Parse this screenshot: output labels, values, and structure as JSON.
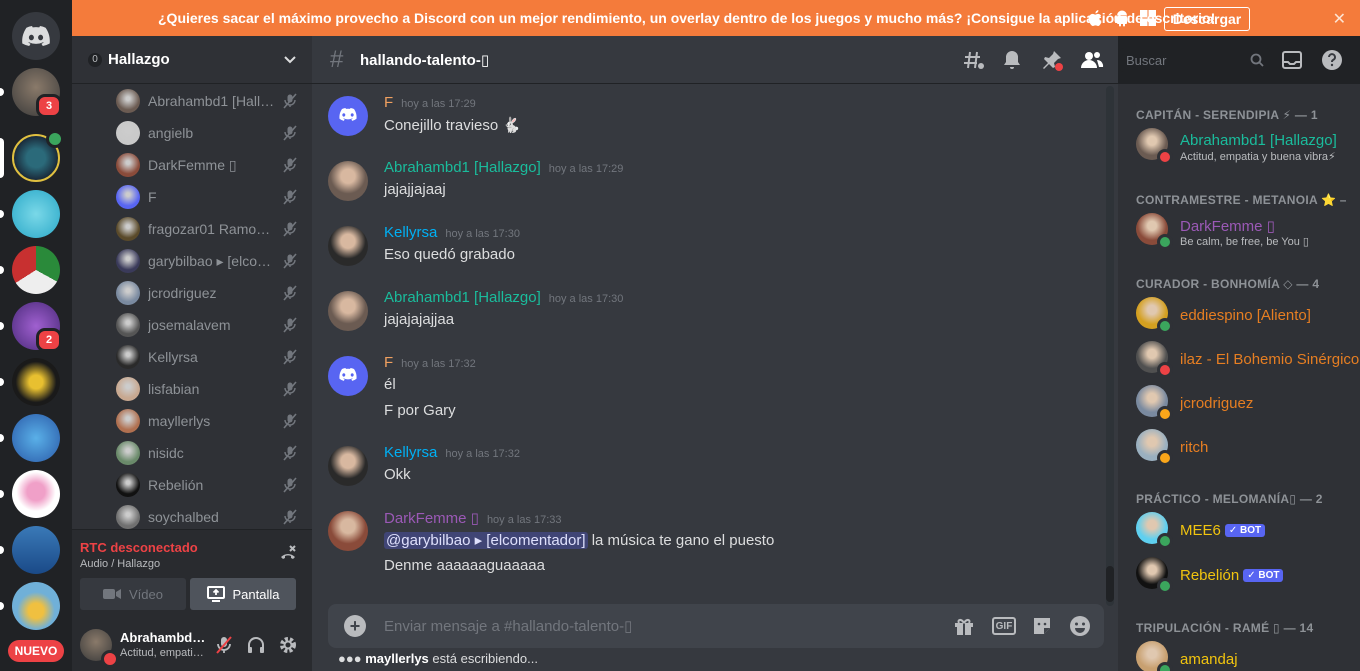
{
  "banner": {
    "text": "¿Quieres sacar el máximo provecho a Discord con un mejor rendimiento, un overlay dentro de los juegos y mucho más? ¡Consigue la aplicación de escritorio!",
    "download_label": "Descargar",
    "close_glyph": "✕"
  },
  "servers": [
    {
      "badge": "3"
    },
    {
      "badge": ""
    },
    {
      "badge": ""
    },
    {
      "badge": ""
    },
    {
      "badge": "2"
    },
    {
      "badge": ""
    },
    {
      "badge": ""
    },
    {
      "badge": ""
    },
    {
      "badge": ""
    },
    {
      "badge": ""
    }
  ],
  "new_label": "NUEVO",
  "guild": {
    "boost": "0",
    "name": "Hallazgo"
  },
  "voice_users": [
    {
      "name": "Abrahambd1 [Hallazgo]",
      "color": "#6b5b52"
    },
    {
      "name": "angielb",
      "color": "#c9c9c9"
    },
    {
      "name": "DarkFemme ▯",
      "color": "#8a4b3a"
    },
    {
      "name": "F",
      "color": "#5865f2"
    },
    {
      "name": "fragozar01 Ramon Fragoza",
      "color": "#5a4a2a"
    },
    {
      "name": "garybilbao ▸ [elcomentador]",
      "color": "#3a3a5a"
    },
    {
      "name": "jcrodriguez",
      "color": "#7a8aa0"
    },
    {
      "name": "josemalavem",
      "color": "#555555"
    },
    {
      "name": "Kellyrsa",
      "color": "#2a2a2a"
    },
    {
      "name": "lisfabian",
      "color": "#c8a890"
    },
    {
      "name": "mayllerlys",
      "color": "#b07050"
    },
    {
      "name": "nisidc",
      "color": "#6a8a6a"
    },
    {
      "name": "Rebelión",
      "color": "#111111"
    },
    {
      "name": "soychalbed",
      "color": "#707070"
    }
  ],
  "rtc": {
    "status": "RTC desconectado",
    "sub": "Audio / Hallazgo",
    "video_label": "Vídeo",
    "screen_label": "Pantalla"
  },
  "user": {
    "name": "Abrahambd1 [Hallazgo]",
    "status": "Actitud, empatia y buena vibra"
  },
  "channel": {
    "name": "hallando-talento-▯",
    "search_placeholder": "Buscar"
  },
  "messages": [
    {
      "author": "F",
      "color": "#f0a060",
      "time": "hoy a las 17:29",
      "lines": [
        "Conejillo travieso 🐇"
      ],
      "avatar": "#5865f2"
    },
    {
      "author": "Abrahambd1 [Hallazgo]",
      "color": "#1abc9c",
      "time": "hoy a las 17:29",
      "lines": [
        "jajajjajaaj"
      ],
      "avatar": "#6b5b52"
    },
    {
      "author": "Kellyrsa",
      "color": "#00b0f4",
      "time": "hoy a las 17:30",
      "lines": [
        "Eso quedó grabado"
      ],
      "avatar": "#2a2a2a"
    },
    {
      "author": "Abrahambd1 [Hallazgo]",
      "color": "#1abc9c",
      "time": "hoy a las 17:30",
      "lines": [
        "jajajajajjaa"
      ],
      "avatar": "#6b5b52"
    },
    {
      "author": "F",
      "color": "#f0a060",
      "time": "hoy a las 17:32",
      "lines": [
        "él",
        "F por Gary"
      ],
      "avatar": "#5865f2"
    },
    {
      "author": "Kellyrsa",
      "color": "#00b0f4",
      "time": "hoy a las 17:32",
      "lines": [
        "Okk"
      ],
      "avatar": "#2a2a2a"
    },
    {
      "author": "DarkFemme ▯",
      "color": "#9b59b6",
      "time": "hoy a las 17:33",
      "mention": "@garybilbao ▸ [elcomentador]",
      "lines": [
        "la música te gano el puesto",
        "Denme aaaaaaguaaaaa"
      ],
      "avatar": "#8a4b3a"
    }
  ],
  "composer": {
    "placeholder": "Enviar mensaje a #hallando-talento-▯",
    "gif_label": "GIF"
  },
  "typing": {
    "user": "mayllerlys",
    "text": "está escribiendo..."
  },
  "members": {
    "categories": [
      {
        "label": "CAPITÁN - SERENDIPIA ⚡ — 1"
      },
      {
        "label": "CONTRAMESTRE - METANOIA ⭐ — 1"
      },
      {
        "label": "CURADOR - BONHOMÍA ◇ — 4"
      },
      {
        "label": "PRÁCTICO - MELOMANÍA▯ — 2"
      },
      {
        "label": "TRIPULACIÓN - RAMÉ ▯ — 14"
      }
    ],
    "people": [
      {
        "name": "Abrahambd1 [Hallazgo]",
        "status": "Actitud, empatia y buena vibra⚡",
        "color": "#1abc9c",
        "avatar": "#6b5b52",
        "dot": "#ed4245"
      },
      {
        "name": "DarkFemme ▯",
        "status": "Be calm, be free, be You ▯",
        "color": "#9b59b6",
        "avatar": "#8a4b3a",
        "dot": "#3ba55d"
      },
      {
        "name": "eddiespino [Aliento]",
        "status": "",
        "color": "#e67e22",
        "avatar": "#d4a020",
        "dot": "#3ba55d"
      },
      {
        "name": "ilaz - El Bohemio Sinérgico",
        "status": "",
        "color": "#e67e22",
        "avatar": "#505050",
        "dot": "#ed4245"
      },
      {
        "name": "jcrodriguez",
        "status": "",
        "color": "#e67e22",
        "avatar": "#7a8aa0",
        "dot": "#faa61a"
      },
      {
        "name": "ritch",
        "status": "",
        "color": "#e67e22",
        "avatar": "#9ab0c0",
        "dot": "#faa61a"
      },
      {
        "name": "MEE6",
        "status": "",
        "color": "#f1c40f",
        "avatar": "#5fd0f0",
        "dot": "#3ba55d",
        "bot": "✓ BOT"
      },
      {
        "name": "Rebelión",
        "status": "",
        "color": "#f1c40f",
        "avatar": "#111111",
        "dot": "#3ba55d",
        "bot": "✓ BOT"
      },
      {
        "name": "amandaj",
        "status": "",
        "color": "#f1c40f",
        "avatar": "#c8a070",
        "dot": "#3ba55d"
      }
    ]
  }
}
